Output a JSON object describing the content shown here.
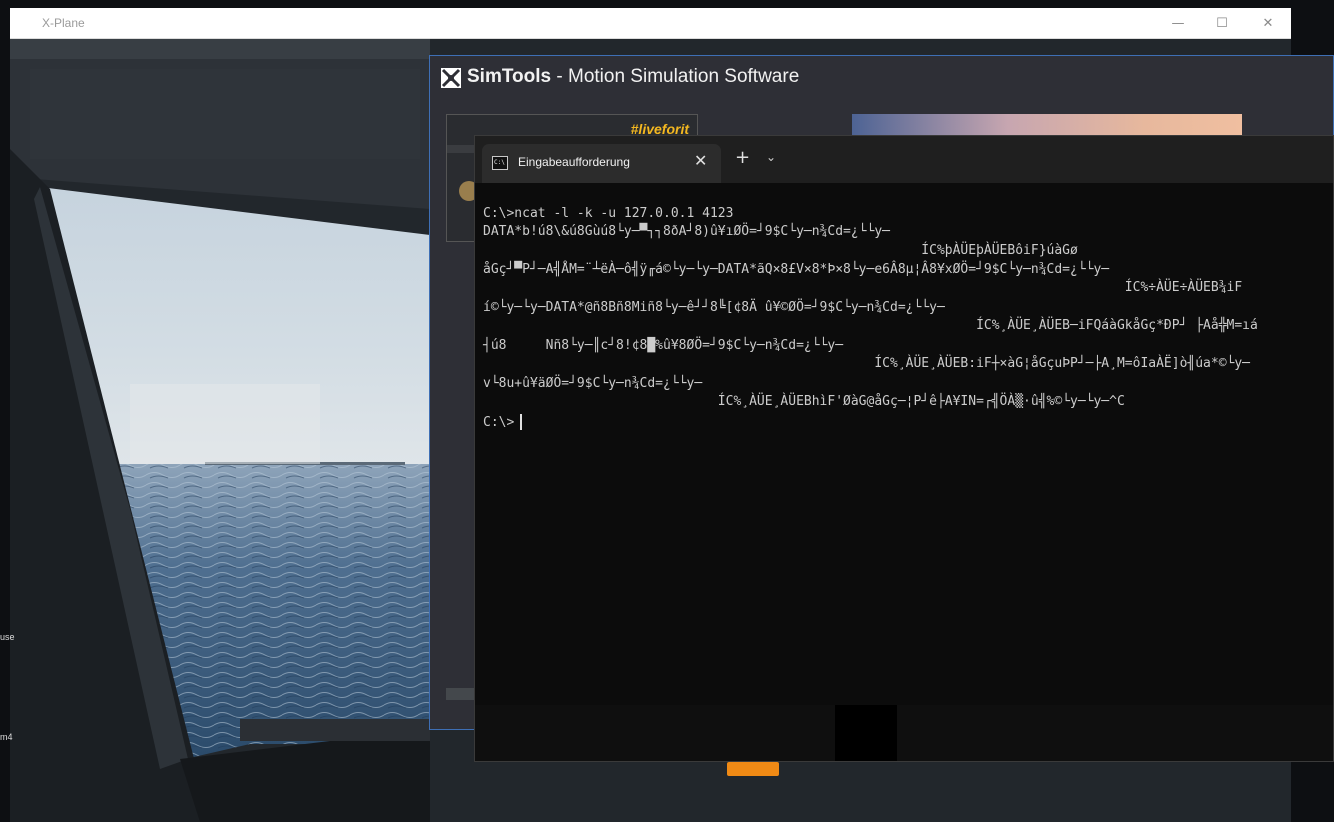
{
  "xplane": {
    "title": "X-Plane",
    "controls": {
      "minimize": "—",
      "maximize": "☐",
      "close": "✕"
    }
  },
  "simtools": {
    "title_brand": "SimTools",
    "title_rest": " - Motion Simulation Software",
    "banner_logo": "#liveforit",
    "accent_color": "#3e6fb5"
  },
  "terminal": {
    "tab_title": "Eingabeaufforderung",
    "tab_close": "✕",
    "new_tab": "+",
    "dropdown": "⌄",
    "lines": [
      "C:\\>ncat -l -k -u 127.0.0.1 4123",
      "DATA*b!ú8\\&ú8Gùú8└y─▀┐┐8ðA┘8)û¥ıØÖ=┘9$C└y─n¾Cd=¿└└y─",
      "                                                        ÍC%þÀÜEþÀÜEBôiF}úàGø",
      "åGç┘▀P┘─A╣ÅM=¨┴ëÀ─ô╣ÿ╓á©└y─└y─DATA*ãQ×8£V×8*Þ×8└y─e6Â8µ¦Â8¥xØÖ=┘9$C└y─n¾Cd=¿└└y─",
      "                                                                                  ÍC%÷ÀÜE÷ÀÜEB¾iF",
      "í©└y─└y─DATA*@ñ8Bñ8Miñ8└y─ê┘┘8╚[¢8Ä û¥©ØÖ=┘9$C└y─n¾Cd=¿└└y─",
      "                                                               ÍC%¸ÀÜE¸ÀÜEB─iFQáàGkåGç*ÐP┘ ├Aå╬M=ıá",
      "┤ú8     Nñ8└y─║c┘8!¢8█%û¥8ØÖ=┘9$C└y─n¾Cd=¿└└y─",
      "                                                  ÍC%¸ÀÜE¸ÀÜEB:iF┼×àG¦åGçuÞP┘─├A¸M=ôIaÀË]ò╢úa*©└y─",
      "v└8u+û¥äØÖ=┘9$C└y─n¾Cd=¿└└y─",
      "                              ÍC%¸ÀÜE¸ÀÜEBhìF'ØàG@åGç─¦P┘ê├A¥IN=┌╣ÖÀ▒·û╣%©└y─└y─^C",
      "C:\\>"
    ]
  },
  "desktop_edge": {
    "text_1": "use",
    "text_2": "m4"
  }
}
